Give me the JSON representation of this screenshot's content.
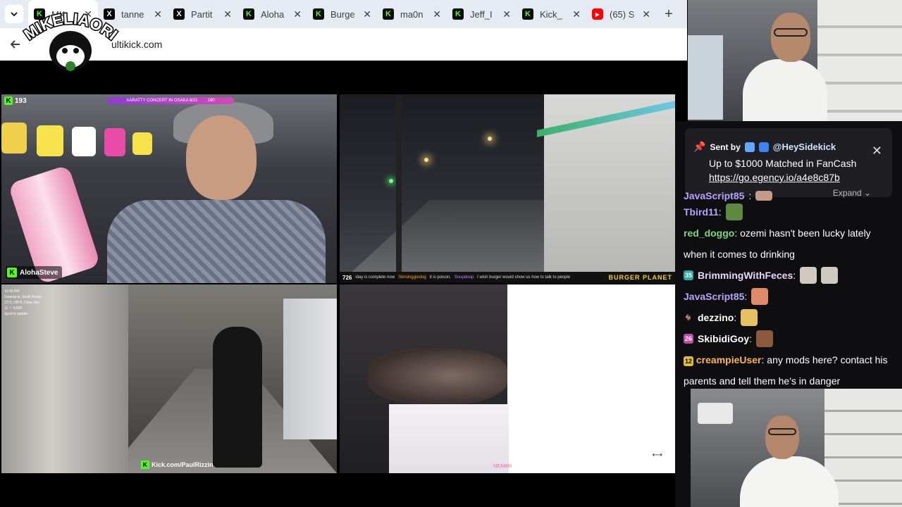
{
  "browser": {
    "tabs": [
      {
        "icon": "kick-icon",
        "label": "MK",
        "active": true
      },
      {
        "icon": "x-icon",
        "label": "tanne"
      },
      {
        "icon": "x-icon",
        "label": "Partit"
      },
      {
        "icon": "kick-icon",
        "label": "Aloha"
      },
      {
        "icon": "kick-icon",
        "label": "Burge"
      },
      {
        "icon": "kick-icon",
        "label": "ma0n"
      },
      {
        "icon": "kick-icon",
        "label": "Jeff_I"
      },
      {
        "icon": "kick-icon",
        "label": "Kick_"
      },
      {
        "icon": "youtube-icon",
        "label": "(65) S"
      }
    ],
    "new_tab": "+",
    "url": "ultikick.com"
  },
  "overlay_logo": {
    "text": "MIKELIAORI"
  },
  "streams": {
    "s1": {
      "viewer_count": "193",
      "banner": "AARATTY CONCERT IN OSAKA 8/21",
      "banner_right": "180",
      "name": "AlohaSteve"
    },
    "s2": {
      "count": "726",
      "ticker": [
        {
          "user": "",
          "text": "iday is complete now"
        },
        {
          "user": "Skindoggiedog",
          "text": "it is poison."
        },
        {
          "user": "Soupdoop",
          "text": "I wish burger would show us how to talk to people"
        }
      ],
      "brand": "BURGER PLANET"
    },
    "s3": {
      "hud": [
        "10:30 PM",
        "Gwangi-si, South Korea",
        "31°C | 88°F, Clear Sky",
        "11  ♡  4,920",
        "!goal to update"
      ],
      "kick_url": "Kick.com/PaulRizzin"
    },
    "s4": {
      "tag": "NEAMIII",
      "arrow": "⟷"
    }
  },
  "chat": {
    "pinned": {
      "sent_by": "Sent by",
      "user": "@HeySidekick",
      "message": "Up to $1000 Matched in FanCash",
      "link": "https://go.egency.io/a4e8c87b",
      "expand": "Expand",
      "close": "✕"
    },
    "messages": [
      {
        "user": "JavaScript85",
        "color": "#b7a3ff",
        "text": "",
        "emote": "#c49a8a",
        "partial": true
      },
      {
        "user": "Tbird11",
        "color": "#b7a3ff",
        "text": "",
        "emote": "#5d8a3e"
      },
      {
        "user": "red_doggo",
        "color": "#7fd67f",
        "text": "ozemi hasn't been lucky lately when it comes to drinking",
        "wrap": true
      },
      {
        "user": "BrimmingWithFeces",
        "color": "#e6d8ff",
        "badge": "35",
        "badge_color": "#2fa8a8",
        "text": "",
        "emote": "#cfcac0",
        "emote2": "#cfcac0"
      },
      {
        "user": "JavaScript85",
        "color": "#b7a3ff",
        "text": "",
        "emote": "#e08a6a"
      },
      {
        "user": "dezzino",
        "color": "#ffffff",
        "badge": "🐐",
        "badge_color": "transparent",
        "text": "",
        "emote": "#e7c060"
      },
      {
        "user": "SkibidiGoy",
        "color": "#ffffff",
        "badge": "26",
        "badge_color": "#c04aa8",
        "text": "",
        "emote": "#8a5a3a"
      },
      {
        "user": "creampieUser",
        "color": "#ffb54a",
        "badge": "12",
        "badge_color": "#e6c02a",
        "text": "any mods here? contact his parents and tell them he's in danger",
        "wrap": true
      }
    ]
  }
}
